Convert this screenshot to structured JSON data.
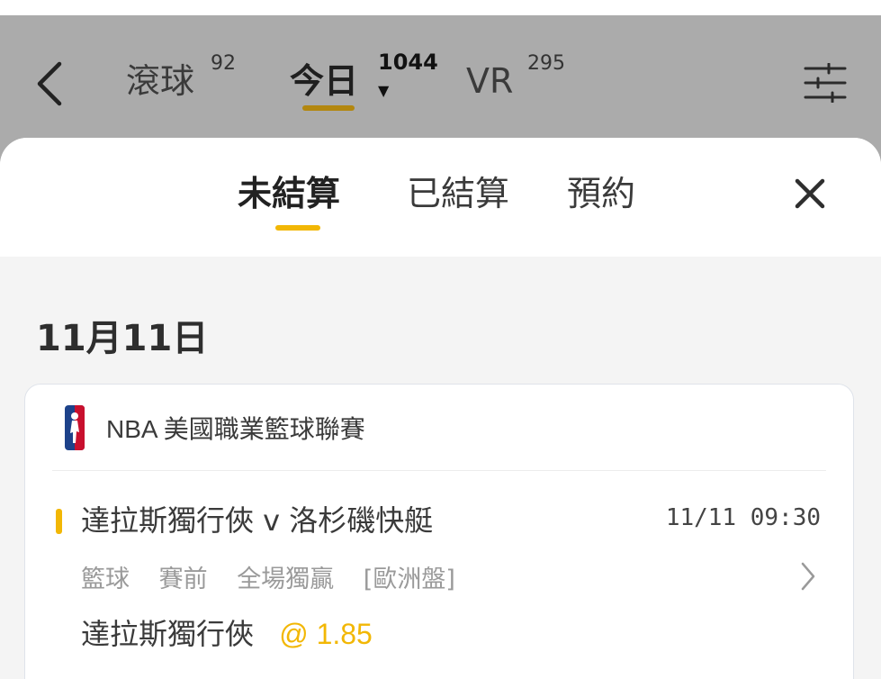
{
  "nav": {
    "tabs": [
      {
        "label": "滾球",
        "count": "92"
      },
      {
        "label": "今日",
        "count": "1044"
      },
      {
        "label": "VR",
        "count": "295"
      }
    ]
  },
  "sheet": {
    "tabs": [
      "未結算",
      "已結算",
      "預約"
    ],
    "active_tab": "未結算"
  },
  "date": "11月11日",
  "bet": {
    "league": "NBA 美國職業籃球聯賽",
    "match": "達拉斯獨行俠 v 洛杉磯快艇",
    "time": "11/11 09:30",
    "market": [
      "籃球",
      "賽前",
      "全場獨贏",
      "[歐洲盤]"
    ],
    "selection": "達拉斯獨行俠",
    "odds": "@ 1.85"
  },
  "colors": {
    "accent": "#f2b705",
    "header_underline": "#b3870f",
    "header_bg": "#ababab"
  },
  "icons": [
    "back-arrow-icon",
    "caret-down-icon",
    "filter-sliders-icon",
    "close-icon",
    "nba-logo-icon",
    "chevron-right-icon"
  ]
}
